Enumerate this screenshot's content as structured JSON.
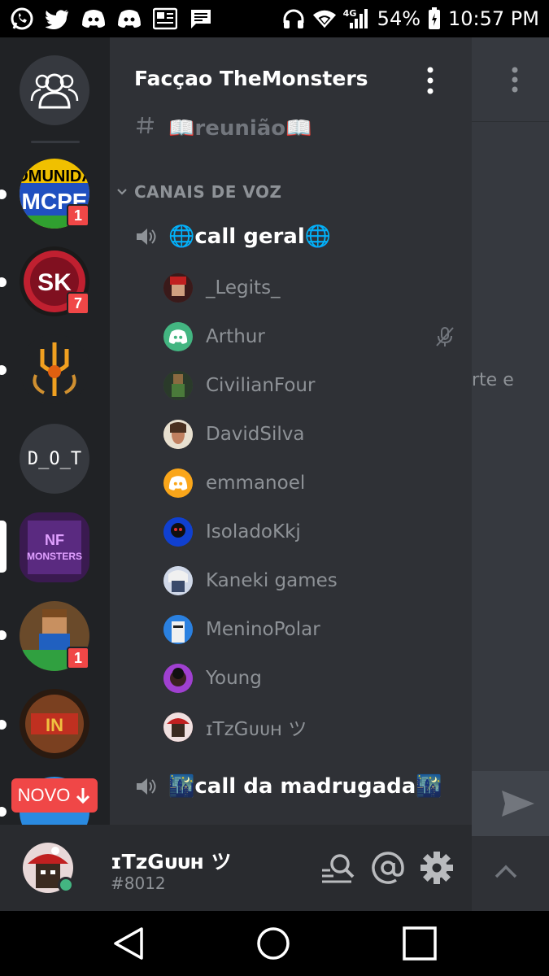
{
  "status_bar": {
    "battery": "54%",
    "time": "10:57 PM",
    "network": "4G",
    "icons": [
      "whatsapp-icon",
      "twitter-icon",
      "discord-icon",
      "discord-icon",
      "news-icon",
      "message-icon",
      "headphones-icon",
      "wifi-icon",
      "signal-icon",
      "battery-icon"
    ]
  },
  "server": {
    "name": "Facçao TheMonsters",
    "text_channel": "📖reunião📖",
    "category": "CANAIS DE VOZ"
  },
  "voice_channels": [
    {
      "name": "🌐call geral🌐"
    },
    {
      "name": "🌃call da madrugada🌃"
    }
  ],
  "members": [
    {
      "name": "_Legits_",
      "avatar_color": "#6b2b2b"
    },
    {
      "name": "Arthur",
      "avatar_color": "#43b581",
      "muted": true
    },
    {
      "name": "CivilianFour",
      "avatar_color": "#3e5a3a"
    },
    {
      "name": "DavidSilva",
      "avatar_color": "#d4b99a"
    },
    {
      "name": "emmanoel",
      "avatar_color": "#faa61a"
    },
    {
      "name": "IsoladoKkj",
      "avatar_color": "#1f3f8f"
    },
    {
      "name": "Kaneki games",
      "avatar_color": "#4a5a7a"
    },
    {
      "name": "MeninoPolar",
      "avatar_color": "#2b6cb0"
    },
    {
      "name": "Young",
      "avatar_color": "#7a3aa0"
    },
    {
      "name": "ɪTzGᴜᴜʜ ツ",
      "avatar_color": "#8a2020"
    }
  ],
  "guilds": [
    {
      "name": "comunidade-mcpe",
      "badge": "1"
    },
    {
      "name": "sk",
      "badge": "7"
    },
    {
      "name": "trident"
    },
    {
      "name": "D_O_T",
      "label": "D_O_T"
    },
    {
      "name": "themonsters",
      "selected": true
    },
    {
      "name": "minecraft-skin",
      "badge": "1"
    },
    {
      "name": "in"
    }
  ],
  "novo_label": "NOVO",
  "chat_partial_text": "rte e",
  "account": {
    "name": "ɪTzGᴜᴜʜ ツ",
    "tag": "#8012",
    "status_color": "#43b581"
  },
  "colors": {
    "accent": "#7289da",
    "danger": "#f04747",
    "online": "#43b581"
  }
}
